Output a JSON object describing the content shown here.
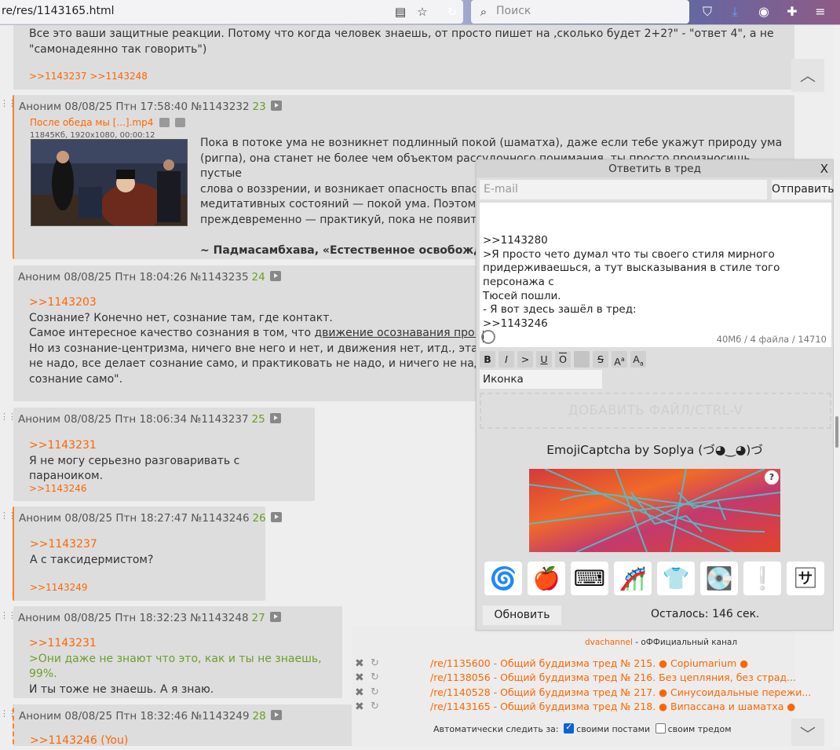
{
  "browser": {
    "url": "re/res/1143165.html",
    "search_placeholder": "Поиск"
  },
  "posts": [
    {
      "lines": [
        "Все это ваши защитные реакции. Потому что когда человек знаешь, от просто пишет на ,сколько будет 2+2?\" - \"ответ 4\", а не",
        "\"самонадеянно так говорить\")"
      ],
      "replies": ">>1143237 >>1143248"
    },
    {
      "header": "Аноним 08/08/25 Птн 17:58:40 №1143232",
      "num": "23",
      "file_name": "После обеда мы [...].mp4",
      "file_meta": "11845Кб, 1920x1080, 00:00:12",
      "lines": [
        "Пока в потоке ума не возникнет подлинный покой (шаматха), даже если тебе укажут природу ума",
        "(ригпа), она станет не более чем объектом рассудочного понимания, ты просто произносишь пустые",
        "слова о воззрении, и возникает опасность впасть в",
        "медитативных состояний — покой ума. Поэтому не",
        "преждевременно — практикуй, пока не появится с"
      ],
      "quote": "~ Падмасамбхава, «Естественное освобождение"
    },
    {
      "header": "Аноним 08/08/25 Птн 18:04:26 №1143235",
      "num": "24",
      "link": ">>1143203",
      "lines": [
        "Сознание? Конечно нет, сознание там, где контакт.",
        "Самое интересное качество сознания в том, что",
        "Но из сознание-центризма, ничего вне него и нет, и движения нет, итд., эта лин",
        "не надо, все делает сознание само, и практиковать не надо, и ничего не надо. Т",
        "сознание само\"."
      ],
      "underlined": "движение осознавания происход"
    },
    {
      "header": "Аноним 08/08/25 Птн 18:06:34 №1143237",
      "num": "25",
      "link": ">>1143231",
      "text": "Я не могу серьезно разговаривать с параноиком.",
      "replies": ">>1143246"
    },
    {
      "header": "Аноним 08/08/25 Птн 18:27:47 №1143246",
      "num": "26",
      "link": ">>1143237",
      "text": "А с таксидермистом?",
      "replies": ">>1143249"
    },
    {
      "header": "Аноним 08/08/25 Птн 18:32:23 №1143248",
      "num": "27",
      "link": ">>1143231",
      "greentext": ">Они даже не знают что это, как и ты не знаешь, 99%.",
      "text": "И ты тоже не знаешь. А я знаю."
    },
    {
      "header": "Аноним 08/08/25 Птн 18:32:46 №1143249",
      "num": "28",
      "link": ">>1143246 (You)"
    }
  ],
  "reply_form": {
    "title": "Ответить в тред",
    "close": "X",
    "email_placeholder": "E-mail",
    "send": "Отправить",
    "message_lines": [
      ">>1143280",
      ">Я просто чето думал что ты своего стиля мирного",
      "придерживаешься, а тут высказывания в стиле того персонажа с",
      "Тюсей пошли.",
      "- Я вот здесь зашёл в тред:",
      ">>1143246"
    ],
    "limits": "40Мб / 4 файла / 14710",
    "format_buttons": [
      "B",
      "I",
      ">",
      "U",
      "O",
      "",
      "S",
      "A",
      "A"
    ],
    "icon_select": "Иконка",
    "add_file": "ДОБАВИТЬ ФАЙЛ/CTRL-V",
    "captcha_title": "EmojiCaptcha by Soplya (づ◕‿◕)づ",
    "captcha_help": "?",
    "emoji_icons": [
      "spiral-icon",
      "apple-icon",
      "keyboard-icon",
      "roller-coaster-icon",
      "tshirt-icon",
      "floppy-disk-icon",
      "exclamation-icon",
      "katakana-sa-icon"
    ],
    "emoji_glyphs": [
      "🌀",
      "🍎",
      "⌨",
      "🎢",
      "👕",
      "💽",
      "❕",
      "🈂"
    ],
    "refresh": "Обновить",
    "remaining": "Осталось: 146 сек."
  },
  "favorites": {
    "channel_link": "dvachannel",
    "channel_text": "- оФФициальный канал",
    "threads": [
      "/re/1135600 - Общий буддизма тред № 215. ● Copiumarium ●",
      "/re/1138056 - Общий буддизма тред № 216. Без цепляния, без страд...",
      "/re/1140528 - Общий буддизма тред № 217. ● Синусоидальные пережи...",
      "/re/1143165 - Общий буддизма тред № 218. ● Випассана и шаматха ●"
    ],
    "auto_label": "Автоматически следить за:",
    "opt_posts": "своими постами",
    "opt_thread": "своим тредом"
  },
  "colors": {
    "accent": "#ff6600",
    "green": "#6aa02a",
    "post_bg": "#dddddd",
    "page_bg": "#eeeeee"
  }
}
